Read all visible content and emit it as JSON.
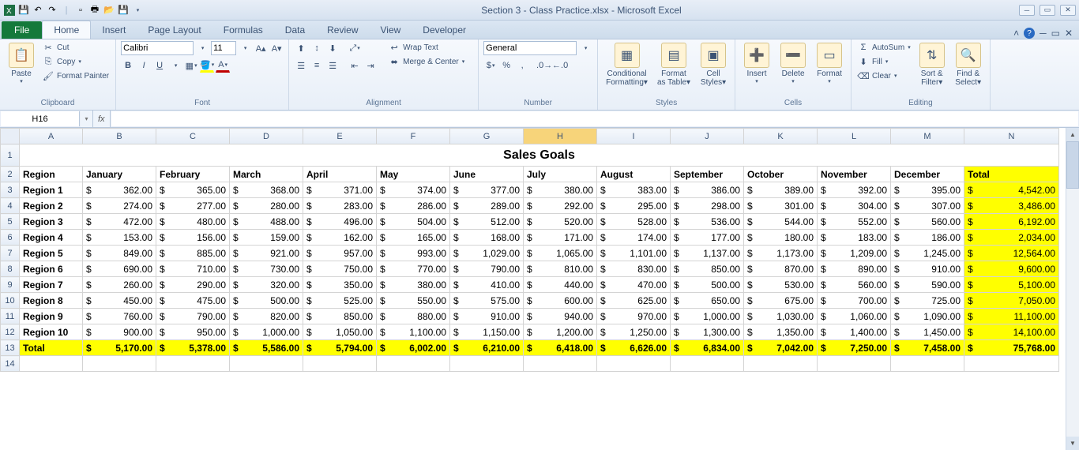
{
  "title": "Section 3 - Class Practice.xlsx - Microsoft Excel",
  "tabs": {
    "file": "File",
    "home": "Home",
    "insert": "Insert",
    "pagelayout": "Page Layout",
    "formulas": "Formulas",
    "data": "Data",
    "review": "Review",
    "view": "View",
    "developer": "Developer"
  },
  "ribbon": {
    "clipboard": {
      "label": "Clipboard",
      "paste": "Paste",
      "cut": "Cut",
      "copy": "Copy",
      "format_painter": "Format Painter"
    },
    "font": {
      "label": "Font",
      "name": "Calibri",
      "size": "11"
    },
    "alignment": {
      "label": "Alignment",
      "wrap": "Wrap Text",
      "merge": "Merge & Center"
    },
    "number": {
      "label": "Number",
      "format": "General"
    },
    "styles": {
      "label": "Styles",
      "cond": "Conditional Formatting",
      "table": "Format as Table",
      "cell": "Cell Styles"
    },
    "cells": {
      "label": "Cells",
      "insert": "Insert",
      "delete": "Delete",
      "format": "Format"
    },
    "editing": {
      "label": "Editing",
      "autosum": "AutoSum",
      "fill": "Fill",
      "clear": "Clear",
      "sort": "Sort & Filter",
      "find": "Find & Select"
    }
  },
  "namebox": "H16",
  "sheet": {
    "columns": [
      "A",
      "B",
      "C",
      "D",
      "E",
      "F",
      "G",
      "H",
      "I",
      "J",
      "K",
      "L",
      "M",
      "N"
    ],
    "active_col": "H",
    "widths": {
      "A": 80,
      "data": 93,
      "total": 120
    },
    "title": "Sales Goals",
    "months": [
      "January",
      "February",
      "March",
      "April",
      "May",
      "June",
      "July",
      "August",
      "September",
      "October",
      "November",
      "December"
    ],
    "total_label": "Total",
    "rows": [
      {
        "region": "Region 1",
        "v": [
          "362.00",
          "365.00",
          "368.00",
          "371.00",
          "374.00",
          "377.00",
          "380.00",
          "383.00",
          "386.00",
          "389.00",
          "392.00",
          "395.00"
        ],
        "total": "4,542.00"
      },
      {
        "region": "Region 2",
        "v": [
          "274.00",
          "277.00",
          "280.00",
          "283.00",
          "286.00",
          "289.00",
          "292.00",
          "295.00",
          "298.00",
          "301.00",
          "304.00",
          "307.00"
        ],
        "total": "3,486.00"
      },
      {
        "region": "Region 3",
        "v": [
          "472.00",
          "480.00",
          "488.00",
          "496.00",
          "504.00",
          "512.00",
          "520.00",
          "528.00",
          "536.00",
          "544.00",
          "552.00",
          "560.00"
        ],
        "total": "6,192.00"
      },
      {
        "region": "Region 4",
        "v": [
          "153.00",
          "156.00",
          "159.00",
          "162.00",
          "165.00",
          "168.00",
          "171.00",
          "174.00",
          "177.00",
          "180.00",
          "183.00",
          "186.00"
        ],
        "total": "2,034.00"
      },
      {
        "region": "Region 5",
        "v": [
          "849.00",
          "885.00",
          "921.00",
          "957.00",
          "993.00",
          "1,029.00",
          "1,065.00",
          "1,101.00",
          "1,137.00",
          "1,173.00",
          "1,209.00",
          "1,245.00"
        ],
        "total": "12,564.00"
      },
      {
        "region": "Region 6",
        "v": [
          "690.00",
          "710.00",
          "730.00",
          "750.00",
          "770.00",
          "790.00",
          "810.00",
          "830.00",
          "850.00",
          "870.00",
          "890.00",
          "910.00"
        ],
        "total": "9,600.00"
      },
      {
        "region": "Region 7",
        "v": [
          "260.00",
          "290.00",
          "320.00",
          "350.00",
          "380.00",
          "410.00",
          "440.00",
          "470.00",
          "500.00",
          "530.00",
          "560.00",
          "590.00"
        ],
        "total": "5,100.00"
      },
      {
        "region": "Region 8",
        "v": [
          "450.00",
          "475.00",
          "500.00",
          "525.00",
          "550.00",
          "575.00",
          "600.00",
          "625.00",
          "650.00",
          "675.00",
          "700.00",
          "725.00"
        ],
        "total": "7,050.00"
      },
      {
        "region": "Region 9",
        "v": [
          "760.00",
          "790.00",
          "820.00",
          "850.00",
          "880.00",
          "910.00",
          "940.00",
          "970.00",
          "1,000.00",
          "1,030.00",
          "1,060.00",
          "1,090.00"
        ],
        "total": "11,100.00"
      },
      {
        "region": "Region 10",
        "v": [
          "900.00",
          "950.00",
          "1,000.00",
          "1,050.00",
          "1,100.00",
          "1,150.00",
          "1,200.00",
          "1,250.00",
          "1,300.00",
          "1,350.00",
          "1,400.00",
          "1,450.00"
        ],
        "total": "14,100.00"
      }
    ],
    "totals": {
      "label": "Total",
      "v": [
        "5,170.00",
        "5,378.00",
        "5,586.00",
        "5,794.00",
        "6,002.00",
        "6,210.00",
        "6,418.00",
        "6,626.00",
        "6,834.00",
        "7,042.00",
        "7,250.00",
        "7,458.00"
      ],
      "grand": "75,768.00"
    }
  }
}
